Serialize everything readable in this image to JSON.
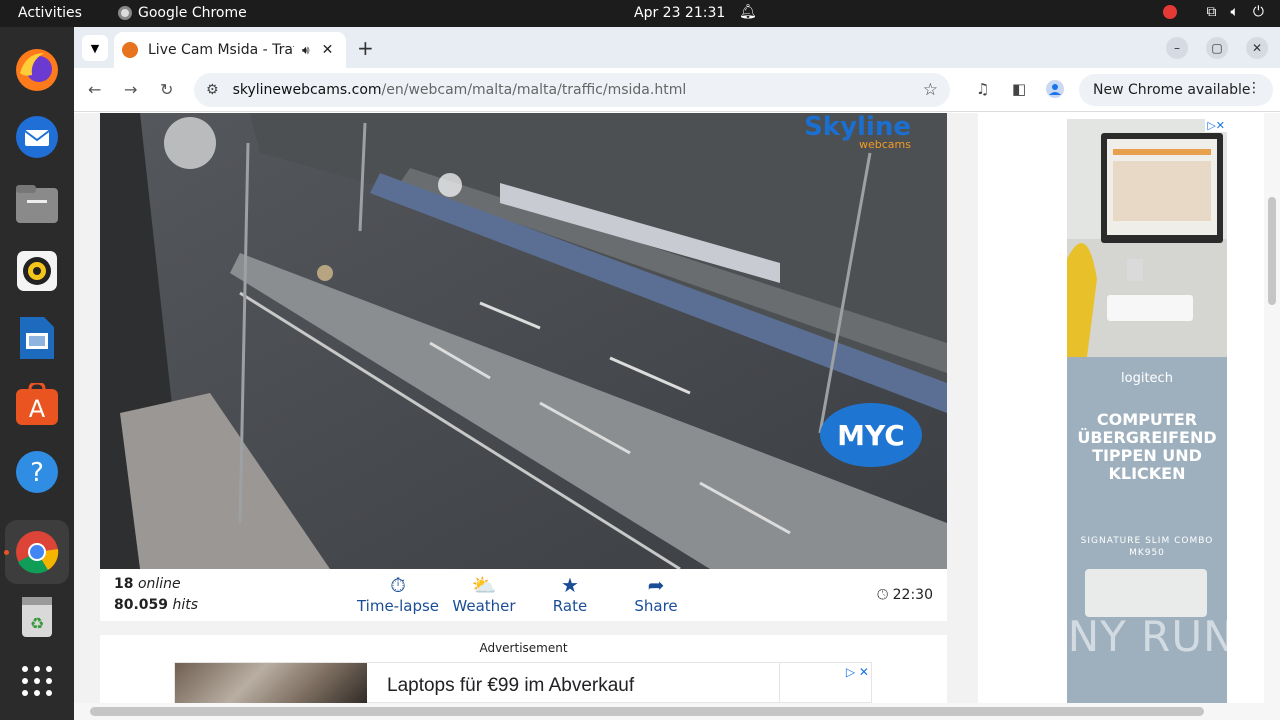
{
  "topbar": {
    "activities": "Activities",
    "app_name": "Google Chrome",
    "clock": "Apr 23  21:31"
  },
  "dock": {
    "apps": [
      "firefox-icon",
      "thunderbird-icon",
      "files-icon",
      "rhythmbox-icon",
      "writer-icon",
      "appcenter-icon",
      "help-icon",
      "chrome-icon",
      "trash-icon",
      "app-grid-icon"
    ]
  },
  "browser": {
    "tab_title": "Live Cam Msida - Traffic",
    "url_host": "skylinewebcams.com",
    "url_path": "/en/webcam/malta/malta/traffic/msida.html",
    "update_label": "New Chrome available"
  },
  "webcam": {
    "logo_main": "Skyline",
    "logo_sub": "webcams",
    "overlay_logo": "MYC",
    "online_count": "18",
    "online_label": "online",
    "hits_count": "80.059",
    "hits_label": "hits",
    "actions": [
      "Time-lapse",
      "Weather",
      "Rate",
      "Share"
    ],
    "local_time": "22:30"
  },
  "advertisement": {
    "label": "Advertisement",
    "headline": "Laptops für €99 im Abverkauf"
  },
  "side_ad": {
    "brand": "logitech",
    "headline": "COMPUTER ÜBERGREIFEND TIPPEN UND KLICKEN",
    "product": "SIGNATURE SLIM COMBO MK950"
  },
  "watermark": "ANY RUN"
}
